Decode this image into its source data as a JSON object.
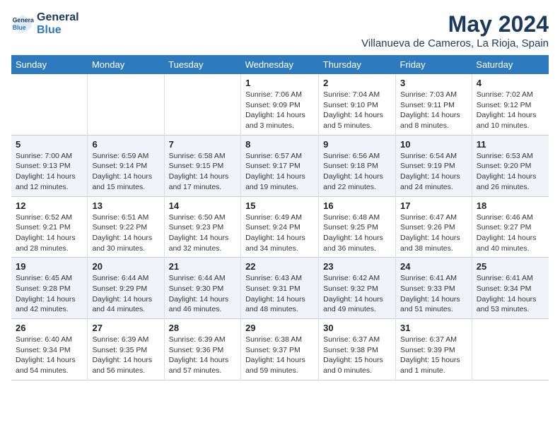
{
  "header": {
    "logo_line1": "General",
    "logo_line2": "Blue",
    "month_year": "May 2024",
    "location": "Villanueva de Cameros, La Rioja, Spain"
  },
  "days_of_week": [
    "Sunday",
    "Monday",
    "Tuesday",
    "Wednesday",
    "Thursday",
    "Friday",
    "Saturday"
  ],
  "weeks": [
    [
      {
        "num": "",
        "info": ""
      },
      {
        "num": "",
        "info": ""
      },
      {
        "num": "",
        "info": ""
      },
      {
        "num": "1",
        "info": "Sunrise: 7:06 AM\nSunset: 9:09 PM\nDaylight: 14 hours\nand 3 minutes."
      },
      {
        "num": "2",
        "info": "Sunrise: 7:04 AM\nSunset: 9:10 PM\nDaylight: 14 hours\nand 5 minutes."
      },
      {
        "num": "3",
        "info": "Sunrise: 7:03 AM\nSunset: 9:11 PM\nDaylight: 14 hours\nand 8 minutes."
      },
      {
        "num": "4",
        "info": "Sunrise: 7:02 AM\nSunset: 9:12 PM\nDaylight: 14 hours\nand 10 minutes."
      }
    ],
    [
      {
        "num": "5",
        "info": "Sunrise: 7:00 AM\nSunset: 9:13 PM\nDaylight: 14 hours\nand 12 minutes."
      },
      {
        "num": "6",
        "info": "Sunrise: 6:59 AM\nSunset: 9:14 PM\nDaylight: 14 hours\nand 15 minutes."
      },
      {
        "num": "7",
        "info": "Sunrise: 6:58 AM\nSunset: 9:15 PM\nDaylight: 14 hours\nand 17 minutes."
      },
      {
        "num": "8",
        "info": "Sunrise: 6:57 AM\nSunset: 9:17 PM\nDaylight: 14 hours\nand 19 minutes."
      },
      {
        "num": "9",
        "info": "Sunrise: 6:56 AM\nSunset: 9:18 PM\nDaylight: 14 hours\nand 22 minutes."
      },
      {
        "num": "10",
        "info": "Sunrise: 6:54 AM\nSunset: 9:19 PM\nDaylight: 14 hours\nand 24 minutes."
      },
      {
        "num": "11",
        "info": "Sunrise: 6:53 AM\nSunset: 9:20 PM\nDaylight: 14 hours\nand 26 minutes."
      }
    ],
    [
      {
        "num": "12",
        "info": "Sunrise: 6:52 AM\nSunset: 9:21 PM\nDaylight: 14 hours\nand 28 minutes."
      },
      {
        "num": "13",
        "info": "Sunrise: 6:51 AM\nSunset: 9:22 PM\nDaylight: 14 hours\nand 30 minutes."
      },
      {
        "num": "14",
        "info": "Sunrise: 6:50 AM\nSunset: 9:23 PM\nDaylight: 14 hours\nand 32 minutes."
      },
      {
        "num": "15",
        "info": "Sunrise: 6:49 AM\nSunset: 9:24 PM\nDaylight: 14 hours\nand 34 minutes."
      },
      {
        "num": "16",
        "info": "Sunrise: 6:48 AM\nSunset: 9:25 PM\nDaylight: 14 hours\nand 36 minutes."
      },
      {
        "num": "17",
        "info": "Sunrise: 6:47 AM\nSunset: 9:26 PM\nDaylight: 14 hours\nand 38 minutes."
      },
      {
        "num": "18",
        "info": "Sunrise: 6:46 AM\nSunset: 9:27 PM\nDaylight: 14 hours\nand 40 minutes."
      }
    ],
    [
      {
        "num": "19",
        "info": "Sunrise: 6:45 AM\nSunset: 9:28 PM\nDaylight: 14 hours\nand 42 minutes."
      },
      {
        "num": "20",
        "info": "Sunrise: 6:44 AM\nSunset: 9:29 PM\nDaylight: 14 hours\nand 44 minutes."
      },
      {
        "num": "21",
        "info": "Sunrise: 6:44 AM\nSunset: 9:30 PM\nDaylight: 14 hours\nand 46 minutes."
      },
      {
        "num": "22",
        "info": "Sunrise: 6:43 AM\nSunset: 9:31 PM\nDaylight: 14 hours\nand 48 minutes."
      },
      {
        "num": "23",
        "info": "Sunrise: 6:42 AM\nSunset: 9:32 PM\nDaylight: 14 hours\nand 49 minutes."
      },
      {
        "num": "24",
        "info": "Sunrise: 6:41 AM\nSunset: 9:33 PM\nDaylight: 14 hours\nand 51 minutes."
      },
      {
        "num": "25",
        "info": "Sunrise: 6:41 AM\nSunset: 9:34 PM\nDaylight: 14 hours\nand 53 minutes."
      }
    ],
    [
      {
        "num": "26",
        "info": "Sunrise: 6:40 AM\nSunset: 9:34 PM\nDaylight: 14 hours\nand 54 minutes."
      },
      {
        "num": "27",
        "info": "Sunrise: 6:39 AM\nSunset: 9:35 PM\nDaylight: 14 hours\nand 56 minutes."
      },
      {
        "num": "28",
        "info": "Sunrise: 6:39 AM\nSunset: 9:36 PM\nDaylight: 14 hours\nand 57 minutes."
      },
      {
        "num": "29",
        "info": "Sunrise: 6:38 AM\nSunset: 9:37 PM\nDaylight: 14 hours\nand 59 minutes."
      },
      {
        "num": "30",
        "info": "Sunrise: 6:37 AM\nSunset: 9:38 PM\nDaylight: 15 hours\nand 0 minutes."
      },
      {
        "num": "31",
        "info": "Sunrise: 6:37 AM\nSunset: 9:39 PM\nDaylight: 15 hours\nand 1 minute."
      },
      {
        "num": "",
        "info": ""
      }
    ]
  ]
}
